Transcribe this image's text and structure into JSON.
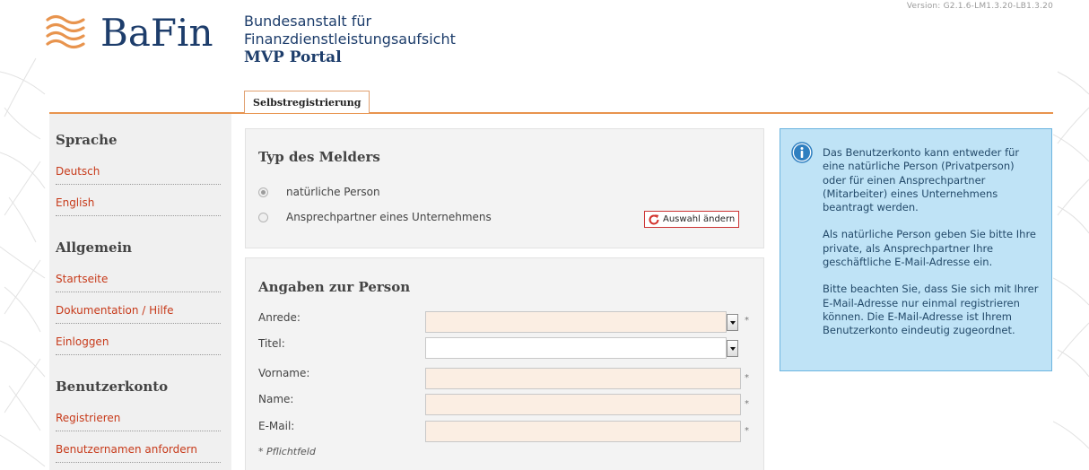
{
  "version": "Version: G2.1.6-LM1.3.20-LB1.3.20",
  "logo": {
    "text": "BaFin",
    "icon": "bafin-waves-logo"
  },
  "header": {
    "org_line1": "Bundesanstalt für",
    "org_line2": "Finanzdienstleistungsaufsicht",
    "portal": "MVP Portal"
  },
  "tabs": [
    {
      "label": "Selbstregistrierung",
      "active": true
    }
  ],
  "sidebar": {
    "sections": [
      {
        "heading": "Sprache",
        "items": [
          "Deutsch",
          "English"
        ]
      },
      {
        "heading": "Allgemein",
        "items": [
          "Startseite",
          "Dokumentation / Hilfe",
          "Einloggen"
        ]
      },
      {
        "heading": "Benutzerkonto",
        "items": [
          "Registrieren",
          "Benutzernamen anfordern"
        ]
      }
    ]
  },
  "melder": {
    "title": "Typ des Melders",
    "options": [
      {
        "label": "natürliche Person",
        "checked": true
      },
      {
        "label": "Ansprechpartner eines Unternehmens",
        "checked": false
      }
    ],
    "change_button": "Auswahl ändern",
    "change_icon": "refresh-icon"
  },
  "person": {
    "title": "Angaben zur Person",
    "fields": [
      {
        "label": "Anrede:",
        "type": "select",
        "value": "",
        "required": true
      },
      {
        "label": "Titel:",
        "type": "select",
        "value": "",
        "required": false
      },
      {
        "label": "Vorname:",
        "type": "text",
        "value": "",
        "required": true
      },
      {
        "label": "Name:",
        "type": "text",
        "value": "",
        "required": true
      },
      {
        "label": "E-Mail:",
        "type": "text",
        "value": "",
        "required": true
      }
    ],
    "required_marker": "*",
    "required_hint": "* Pflichtfeld"
  },
  "info": {
    "icon": "info-icon",
    "paragraphs": [
      "Das Benutzerkonto kann entweder für eine natürliche Person (Privatperson) oder für einen Ansprechpartner (Mitarbeiter) eines Unternehmens beantragt werden.",
      "Als natürliche Person geben Sie bitte Ihre private, als Ansprechpartner Ihre geschäftliche E-Mail-Adresse ein.",
      "Bitte beachten Sie, dass Sie sich mit Ihrer E-Mail-Adresse nur einmal registrieren können. Die E-Mail-Adresse ist Ihrem Benutzerkonto eindeutig zugeordnet."
    ]
  },
  "colors": {
    "brand_blue": "#1d3d6b",
    "accent_orange": "#e8944e",
    "link_red": "#c73a1a",
    "required_field_bg": "#fbeee3",
    "info_bg": "#bfe3f6",
    "info_border": "#6db5e0"
  }
}
